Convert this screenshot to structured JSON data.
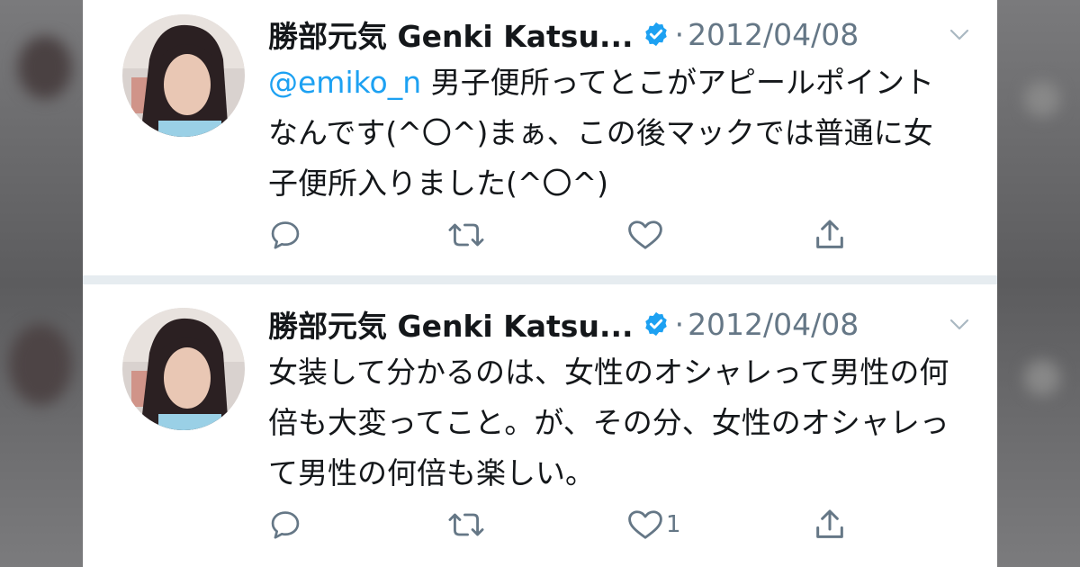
{
  "colors": {
    "text": "#14171a",
    "secondary": "#657786",
    "accent": "#1da1f2",
    "separator": "#e6ecf0"
  },
  "tweets": [
    {
      "author_name": "勝部元気 Genki Katsu...",
      "verified": true,
      "separator_dot": "·",
      "date": "2012/04/08",
      "mention": "@emiko_n",
      "text": " 男子便所ってとこがアピールポイントなんです(^〇^)まぁ、この後マックでは普通に女子便所入りました(^〇^)",
      "icons": [
        "reply-icon",
        "retweet-icon",
        "like-icon",
        "share-icon"
      ],
      "like_count": ""
    },
    {
      "author_name": "勝部元気 Genki Katsu...",
      "verified": true,
      "separator_dot": "·",
      "date": "2012/04/08",
      "mention": "",
      "text": "女装して分かるのは、女性のオシャレって男性の何倍も大変ってこと。が、その分、女性のオシャレって男性の何倍も楽しい。",
      "icons": [
        "reply-icon",
        "retweet-icon",
        "like-icon",
        "share-icon"
      ],
      "like_count": "1"
    }
  ]
}
